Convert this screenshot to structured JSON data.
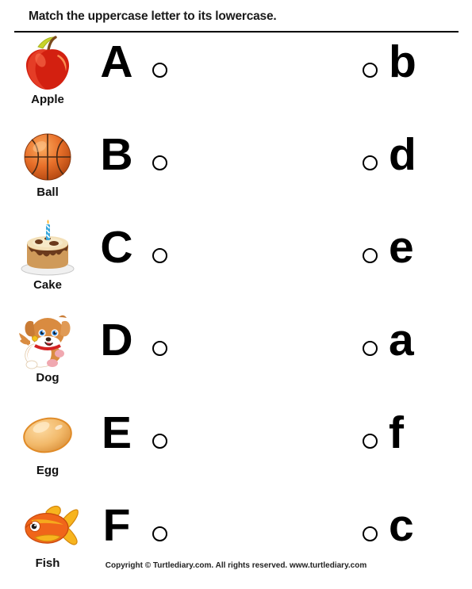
{
  "header": {
    "title": "Match the uppercase letter to its lowercase."
  },
  "footer": {
    "copyright": "Copyright © Turtlediary.com. All rights reserved. www.turtlediary.com"
  },
  "colors": {
    "page_background": "#ffffff",
    "text": "#000000",
    "rule": "#000000",
    "apple_red": "#d32010",
    "apple_leaf": "#c8d42a",
    "apple_stem": "#7a4a1e",
    "ball_orange": "#e8702a",
    "ball_line": "#4a2a14",
    "cake_brown": "#6b3a1c",
    "cake_cream": "#f3e0b8",
    "cake_body": "#cf9a5a",
    "candle_blue": "#3aa8dc",
    "dog_tan": "#d98b40",
    "dog_white": "#ffffff",
    "dog_collar": "#d42222",
    "egg_tan": "#f2b96a",
    "fish_orange": "#f0651a",
    "fish_yellow": "#f7b41e"
  },
  "rows": [
    {
      "picture": "apple-picture",
      "label": "Apple",
      "uppercase": "A",
      "left_bubble": "bubble-a",
      "right_bubble": "bubble-b",
      "lowercase": "b"
    },
    {
      "picture": "basketball-picture",
      "label": "Ball",
      "uppercase": "B",
      "left_bubble": "bubble-b",
      "right_bubble": "bubble-d",
      "lowercase": "d"
    },
    {
      "picture": "cake-picture",
      "label": "Cake",
      "uppercase": "C",
      "left_bubble": "bubble-c",
      "right_bubble": "bubble-e",
      "lowercase": "e"
    },
    {
      "picture": "dog-picture",
      "label": "Dog",
      "uppercase": "D",
      "left_bubble": "bubble-d",
      "right_bubble": "bubble-a",
      "lowercase": "a"
    },
    {
      "picture": "egg-picture",
      "label": "Egg",
      "uppercase": "E",
      "left_bubble": "bubble-e",
      "right_bubble": "bubble-f",
      "lowercase": "f"
    },
    {
      "picture": "fish-picture",
      "label": "Fish",
      "uppercase": "F",
      "left_bubble": "bubble-f",
      "right_bubble": "bubble-c",
      "lowercase": "c"
    }
  ]
}
